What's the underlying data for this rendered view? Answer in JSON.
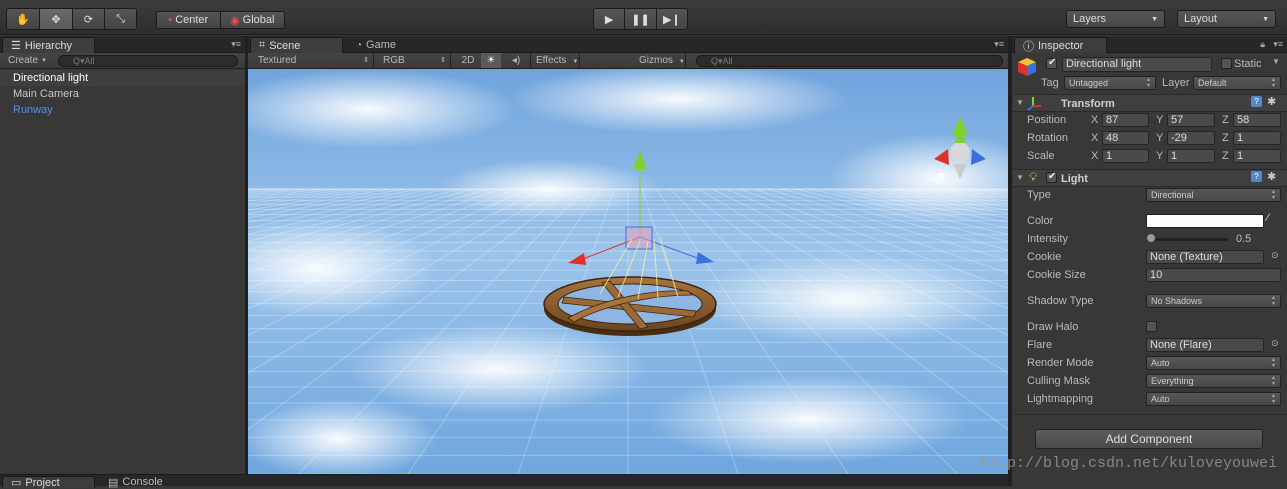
{
  "toolbar": {
    "tools": [
      "hand-tool",
      "move-tool",
      "rotate-tool",
      "scale-tool"
    ],
    "pivot": "Center",
    "space": "Global",
    "play": [
      "play",
      "pause",
      "step"
    ],
    "layers": "Layers",
    "layout": "Layout"
  },
  "hierarchy": {
    "tab": "Hierarchy",
    "create": "Create",
    "search_placeholder": "Q▾All",
    "items": [
      {
        "label": "Directional light",
        "selected": true
      },
      {
        "label": "Main Camera",
        "selected": false
      },
      {
        "label": "Runway",
        "selected": false,
        "color": "#5a8fe6"
      }
    ]
  },
  "scene": {
    "tab_scene": "Scene",
    "tab_game": "Game",
    "shading": "Textured",
    "render": "RGB",
    "mode2d": "2D",
    "effects": "Effects",
    "gizmos": "Gizmos",
    "search_placeholder": "Q▾All"
  },
  "inspector": {
    "tab": "Inspector",
    "object_name": "Directional light",
    "static_label": "Static",
    "tag_label": "Tag",
    "tag_value": "Untagged",
    "layer_label": "Layer",
    "layer_value": "Default",
    "transform": {
      "title": "Transform",
      "position": {
        "label": "Position",
        "x": "87",
        "y": "57",
        "z": "58"
      },
      "rotation": {
        "label": "Rotation",
        "x": "48",
        "y": "-29",
        "z": "1"
      },
      "scale": {
        "label": "Scale",
        "x": "1",
        "y": "1",
        "z": "1"
      }
    },
    "light": {
      "title": "Light",
      "type_label": "Type",
      "type_value": "Directional",
      "color_label": "Color",
      "intensity_label": "Intensity",
      "intensity_value": "0.5",
      "intensity_fraction": 0.0625,
      "cookie_label": "Cookie",
      "cookie_value": "None (Texture)",
      "cookie_size_label": "Cookie Size",
      "cookie_size_value": "10",
      "shadow_label": "Shadow Type",
      "shadow_value": "No Shadows",
      "halo_label": "Draw Halo",
      "flare_label": "Flare",
      "flare_value": "None (Flare)",
      "render_label": "Render Mode",
      "render_value": "Auto",
      "culling_label": "Culling Mask",
      "culling_value": "Everything",
      "lightmap_label": "Lightmapping",
      "lightmap_value": "Auto"
    },
    "add_component": "Add Component"
  },
  "bottom": {
    "project": "Project",
    "console": "Console"
  },
  "watermark": "http://blog.csdn.net/kuloveyouwei",
  "colors": {
    "selection": "#3e3e3e",
    "link_blue": "#5a8fe6",
    "axis_x": "#e0302a",
    "axis_y": "#7fd22a",
    "axis_z": "#3b6fe0"
  }
}
